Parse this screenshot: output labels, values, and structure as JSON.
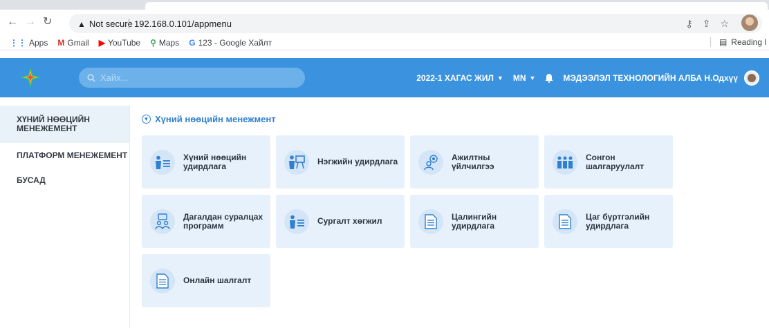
{
  "browser": {
    "security_label": "Not secure",
    "url": "192.168.0.101/appmenu",
    "bookmarks": [
      {
        "label": "Apps",
        "icon": "apps-grid-icon"
      },
      {
        "label": "Gmail",
        "icon": "gmail-icon"
      },
      {
        "label": "YouTube",
        "icon": "youtube-icon"
      },
      {
        "label": "Maps",
        "icon": "maps-icon"
      },
      {
        "label": "123 - Google Хайлт",
        "icon": "google-icon"
      }
    ],
    "reading_list_label": "Reading l"
  },
  "appbar": {
    "search_placeholder": "Хайх...",
    "year_label": "2022-1 ХАГАС ЖИЛ",
    "language_label": "MN",
    "user_label": "МЭДЭЭЛЭЛ ТЕХНОЛОГИЙН АЛБА Н.Одхүү",
    "colors": {
      "bar": "#3b93df",
      "search": "#6db1ea"
    }
  },
  "sidebar": {
    "items": [
      {
        "label": "ХҮНИЙ НӨӨЦИЙН МЕНЕЖЕМЕНТ",
        "active": true
      },
      {
        "label": "ПЛАТФОРМ МЕНЕЖЕМЕНТ",
        "active": false
      },
      {
        "label": "БУСАД",
        "active": false
      }
    ]
  },
  "main": {
    "section_title": "Хүний нөөцийн менежмент",
    "cards": [
      {
        "label": "Хүний нөөцийн удирдлага",
        "icon": "person-list-icon"
      },
      {
        "label": "Нэгжийн удирдлага",
        "icon": "presenter-board-icon"
      },
      {
        "label": "Ажилтны үйлчилгээ",
        "icon": "employee-service-icon"
      },
      {
        "label": "Сонгон шалгаруулалт",
        "icon": "candidates-icon"
      },
      {
        "label": "Дагалдан суралцах программ",
        "icon": "mentoring-icon"
      },
      {
        "label": "Сургалт хөгжил",
        "icon": "training-icon"
      },
      {
        "label": "Цалингийн удирдлага",
        "icon": "document-icon"
      },
      {
        "label": "Цаг бүртгэлийн удирдлага",
        "icon": "document-icon"
      },
      {
        "label": "Онлайн шалгалт",
        "icon": "document-icon"
      }
    ]
  }
}
